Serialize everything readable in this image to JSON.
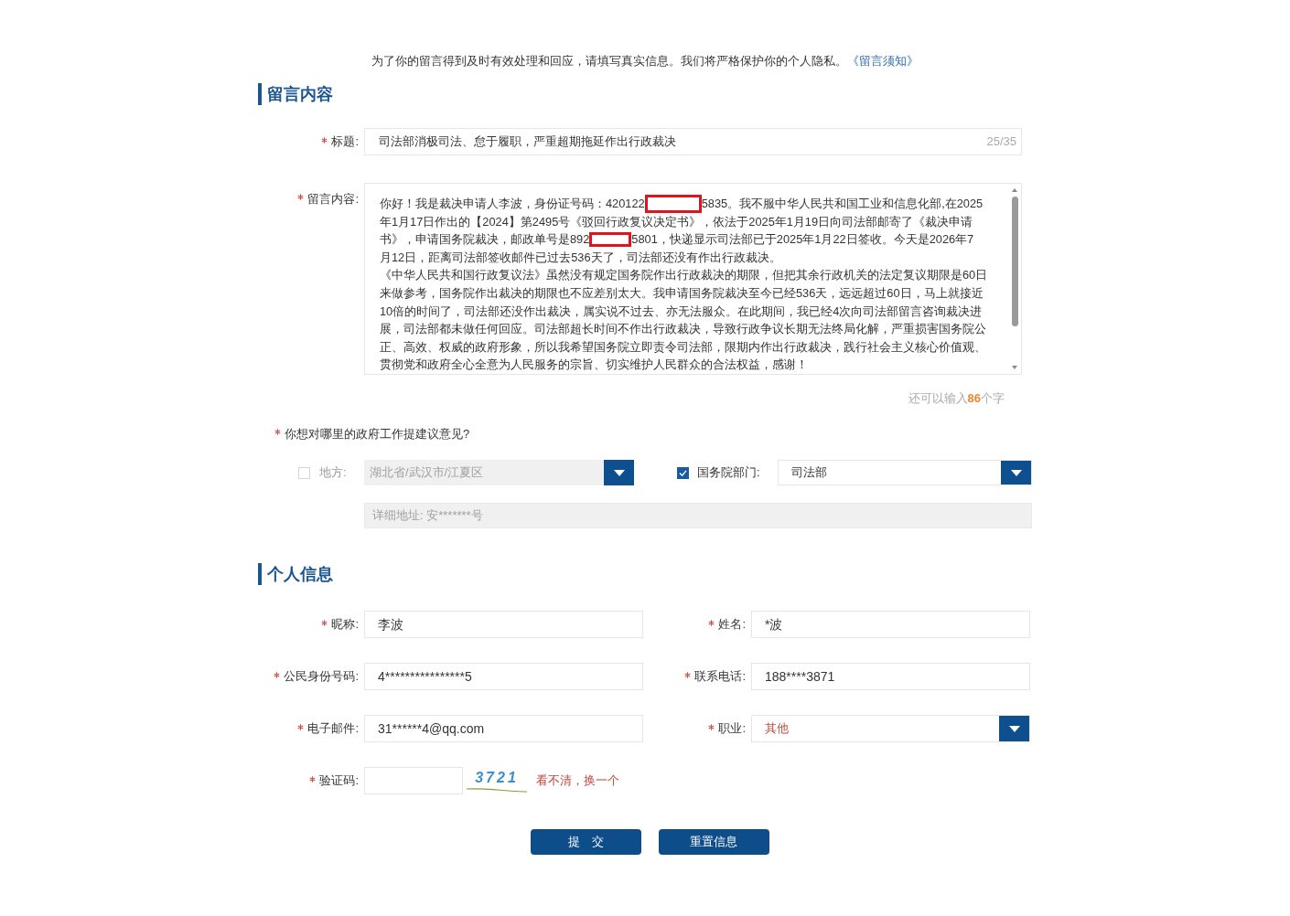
{
  "notice": {
    "text": "为了你的留言得到及时有效处理和回应，请填写真实信息。我们将严格保护你的个人隐私。",
    "link": "《留言须知》"
  },
  "message_section": {
    "heading": "留言内容",
    "title_field": {
      "label": "标题:",
      "required": true,
      "value": "司法部消极司法、怠于履职，严重超期拖延作出行政裁决",
      "counter": "25/35"
    },
    "content_field": {
      "label": "留言内容:",
      "required": true,
      "lines": [
        [
          {
            "kind": "text",
            "text": "你好！我是裁决申请人李波，身份证号码：420122"
          },
          {
            "kind": "redaction"
          },
          {
            "kind": "text",
            "text": "5835。我不服中华人民共和国工业和信息化部,在2025"
          }
        ],
        [
          {
            "kind": "text",
            "text": "年1月17日作出的【2024】第2495号《驳回行政复议决定书》，依法于2025年1月19日向司法部邮寄了《裁决申请"
          }
        ],
        [
          {
            "kind": "text",
            "text": "书》，申请国务院裁决，邮政单号是892"
          },
          {
            "kind": "redaction"
          },
          {
            "kind": "text",
            "text": "5801，快递显示司法部已于2025年1月22日签收。今天是2026年7"
          }
        ],
        [
          {
            "kind": "text",
            "text": "月12日，距离司法部签收邮件已过去536天了，司法部还没有作出行政裁决。"
          }
        ],
        [
          {
            "kind": "text",
            "text": "《中华人民共和国行政复议法》虽然没有规定国务院作出行政裁决的期限，但把其余行政机关的法定复议期限是60日"
          }
        ],
        [
          {
            "kind": "text",
            "text": "来做参考，国务院作出裁决的期限也不应差别太大。我申请国务院裁决至今已经536天，远远超过60日，马上就接近"
          }
        ],
        [
          {
            "kind": "text",
            "text": "10倍的时间了，司法部还没作出裁决，属实说不过去、亦无法服众。在此期间，我已经4次向司法部留言咨询裁决进"
          }
        ],
        [
          {
            "kind": "text",
            "text": "展，司法部都未做任何回应。司法部超长时间不作出行政裁决，导致行政争议长期无法终局化解，严重损害国务院公"
          }
        ],
        [
          {
            "kind": "text",
            "text": "正、高效、权威的政府形象，所以我希望国务院立即责令司法部，限期内作出行政裁决，践行社会主义核心价值观、"
          }
        ],
        [
          {
            "kind": "text",
            "text": "贯彻党和政府全心全意为人民服务的宗旨、切实维护人民群众的合法权益，感谢！"
          }
        ]
      ],
      "remaining": {
        "prefix": "还可以输入",
        "count": "86",
        "suffix": "个字"
      }
    },
    "target": {
      "question": "你想对哪里的政府工作提建议意见?",
      "required": true,
      "local": {
        "checked": false,
        "disabled": true,
        "label": "地方:",
        "value": "湖北省/武汉市/江夏区"
      },
      "department": {
        "checked": true,
        "disabled": false,
        "label": "国务院部门:",
        "value": "司法部"
      },
      "address": {
        "disabled": true,
        "value": "详细地址: 安*******号"
      }
    }
  },
  "personal_section": {
    "heading": "个人信息",
    "fields": [
      {
        "kind": "text",
        "label": "昵称:",
        "required": true,
        "value": "李波"
      },
      {
        "kind": "text",
        "label": "姓名:",
        "required": true,
        "value": "*波"
      },
      {
        "kind": "text",
        "label": "公民身份号码:",
        "required": true,
        "value": "4****************5"
      },
      {
        "kind": "text",
        "label": "联系电话:",
        "required": true,
        "value": "188****3871"
      },
      {
        "kind": "text",
        "label": "电子邮件:",
        "required": true,
        "value": "31******4@qq.com"
      },
      {
        "kind": "select",
        "label": "职业:",
        "required": true,
        "value": "其他"
      },
      {
        "kind": "captcha",
        "label": "验证码:",
        "required": true,
        "image_text": "3721",
        "refresh_link": "看不清，换一个"
      }
    ]
  },
  "buttons": [
    {
      "label": "提　交"
    },
    {
      "label": "重置信息"
    }
  ]
}
